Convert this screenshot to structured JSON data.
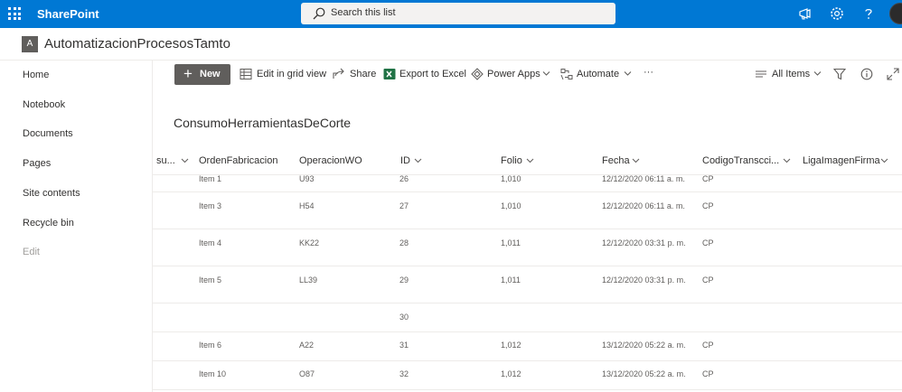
{
  "suitebar": {
    "brand": "SharePoint",
    "search_placeholder": "Search this list"
  },
  "site": {
    "logo_letter": "A",
    "title": "AutomatizacionProcesosTamto"
  },
  "nav": [
    {
      "label": "Home"
    },
    {
      "label": "Notebook"
    },
    {
      "label": "Documents"
    },
    {
      "label": "Pages"
    },
    {
      "label": "Site contents"
    },
    {
      "label": "Recycle bin"
    },
    {
      "label": "Edit"
    }
  ],
  "commandbar": {
    "new_label": "New",
    "grid_view_label": "Edit in grid view",
    "share_label": "Share",
    "export_label": "Export to Excel",
    "powerapps_label": "Power Apps",
    "automate_label": "Automate",
    "more_label": "···",
    "view_label": "All Items"
  },
  "list": {
    "title": "ConsumoHerramientasDeCorte",
    "columns": [
      "su...",
      "OrdenFabricacion",
      "OperacionWO",
      "ID",
      "Folio",
      "Fecha",
      "CodigoTranscci...",
      "LigaImagenFirma"
    ],
    "rows": [
      {
        "orden": "Item 1",
        "operacion": "U93",
        "id": "26",
        "folio": "1,010",
        "fecha": "12/12/2020 06:11 a. m.",
        "codigo": "CP"
      },
      {
        "orden": "Item 3",
        "operacion": "H54",
        "id": "27",
        "folio": "1,010",
        "fecha": "12/12/2020 06:11 a. m.",
        "codigo": "CP"
      },
      {
        "orden": "Item 4",
        "operacion": "KK22",
        "id": "28",
        "folio": "1,011",
        "fecha": "12/12/2020 03:31 p. m.",
        "codigo": "CP"
      },
      {
        "orden": "Item 5",
        "operacion": "LL39",
        "id": "29",
        "folio": "1,011",
        "fecha": "12/12/2020 03:31 p. m.",
        "codigo": "CP"
      },
      {
        "orden": "",
        "operacion": "",
        "id": "30",
        "folio": "",
        "fecha": "",
        "codigo": ""
      },
      {
        "orden": "Item 6",
        "operacion": "A22",
        "id": "31",
        "folio": "1,012",
        "fecha": "13/12/2020 05:22 a. m.",
        "codigo": "CP"
      },
      {
        "orden": "Item 10",
        "operacion": "O87",
        "id": "32",
        "folio": "1,012",
        "fecha": "13/12/2020 05:22 a. m.",
        "codigo": "CP"
      }
    ]
  },
  "colors": {
    "suitebar": "#0078d4",
    "new_button": "#605e5c",
    "excel_green": "#217346"
  }
}
